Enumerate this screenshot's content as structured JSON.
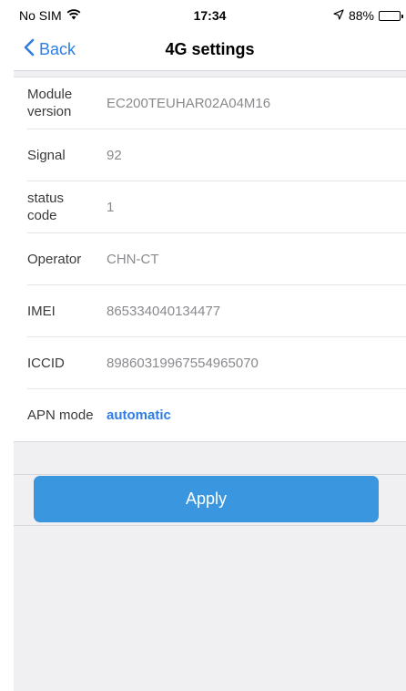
{
  "status_bar": {
    "carrier": "No SIM",
    "time": "17:34",
    "battery": "88%",
    "battery_level": 0.88
  },
  "nav": {
    "back_label": "Back",
    "title": "4G settings"
  },
  "info": {
    "module_version": {
      "label": "Module version",
      "value": "EC200TEUHAR02A04M16"
    },
    "signal": {
      "label": "Signal",
      "value": "92"
    },
    "status_code": {
      "label": "status code",
      "value": "1"
    },
    "operator": {
      "label": "Operator",
      "value": "CHN-CT"
    },
    "imei": {
      "label": "IMEI",
      "value": "865334040134477"
    },
    "iccid": {
      "label": "ICCID",
      "value": "89860319967554965070"
    },
    "apn_mode": {
      "label": "APN mode",
      "value": "automatic"
    }
  },
  "actions": {
    "apply_label": "Apply"
  },
  "colors": {
    "accent": "#2f7de1",
    "button": "#3b96e0",
    "background": "#f0f0f2"
  }
}
